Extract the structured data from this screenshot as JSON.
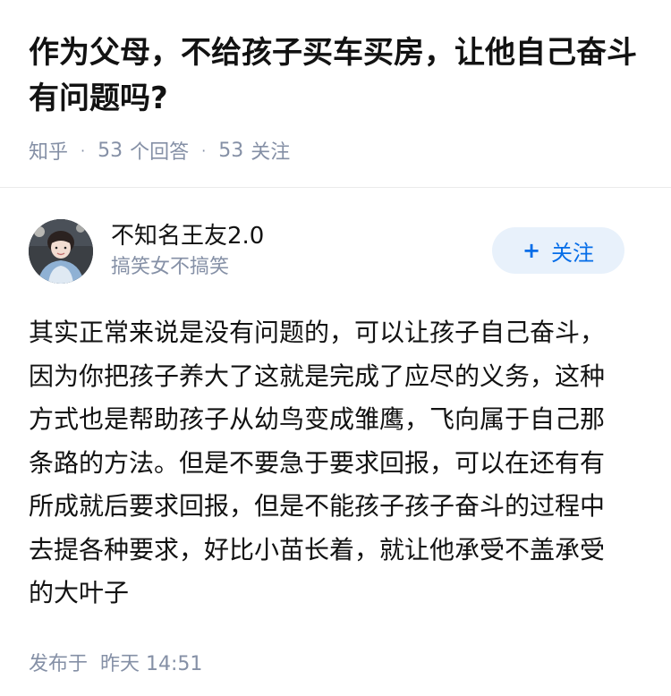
{
  "question": {
    "title": "作为父母，不给孩子买车买房，让他自己奋斗有问题吗?",
    "source": "知乎",
    "answers_count": "53",
    "answers_label": "个回答",
    "followers_count": "53",
    "followers_label": "关注"
  },
  "answer": {
    "author": {
      "name": "不知名王友2.0",
      "bio": "搞笑女不搞笑",
      "avatar_icon": "avatar-photo"
    },
    "follow_button": {
      "icon": "plus",
      "label": "关注"
    },
    "content": "其实正常来说是没有问题的，可以让孩子自己奋斗，因为你把孩子养大了这就是完成了应尽的义务，这种方式也是帮助孩子从幼鸟变成雏鹰，飞向属于自己那条路的方法。但是不要急于要求回报，可以在还有有所成就后要求回报，但是不能孩子孩子奋斗的过程中去提各种要求，好比小苗长着，就让他承受不盖承受的大叶子",
    "publish_label": "发布于",
    "publish_time": "昨天 14:51"
  },
  "colors": {
    "text": "#121212",
    "meta": "#8590a6",
    "accent": "#056de8",
    "button_bg": "#e8f1fb"
  }
}
